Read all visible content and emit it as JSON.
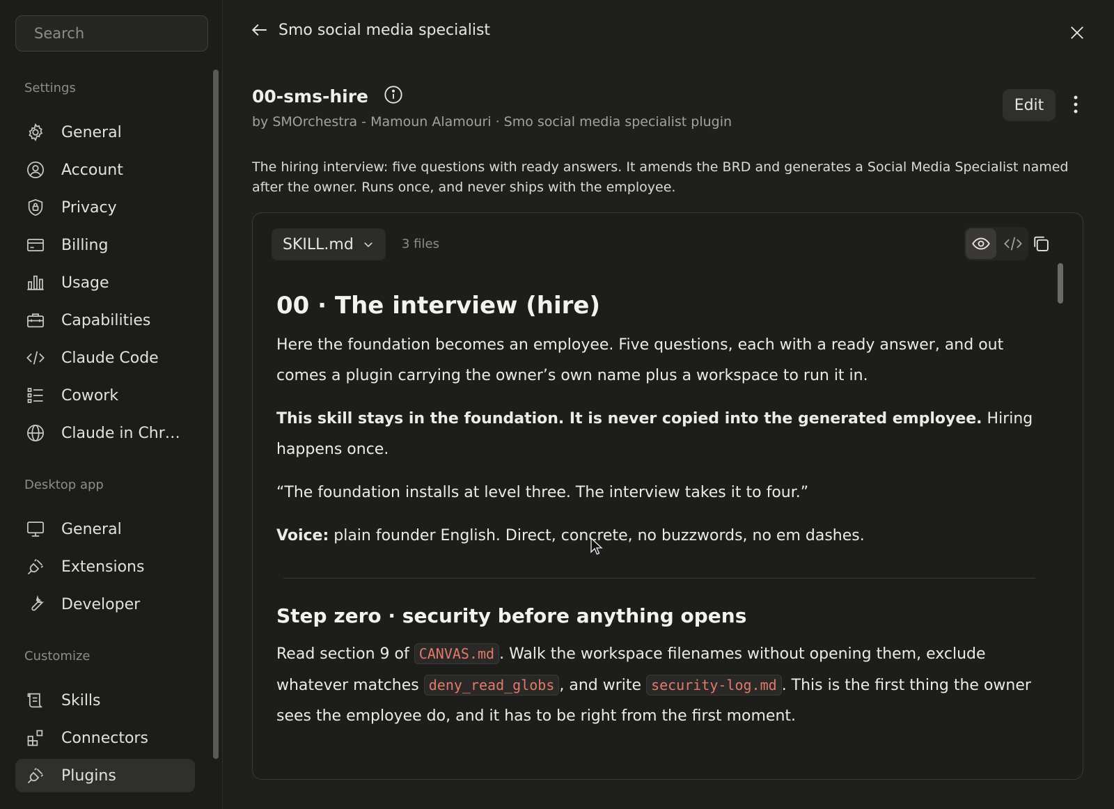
{
  "sidebar": {
    "search_placeholder": "Search",
    "sections": {
      "settings": "Settings",
      "desktop": "Desktop app",
      "customize": "Customize"
    },
    "settings_items": [
      {
        "label": "General",
        "icon": "gear-icon"
      },
      {
        "label": "Account",
        "icon": "user-circle-icon"
      },
      {
        "label": "Privacy",
        "icon": "shield-icon"
      },
      {
        "label": "Billing",
        "icon": "credit-card-icon"
      },
      {
        "label": "Usage",
        "icon": "bar-chart-icon"
      },
      {
        "label": "Capabilities",
        "icon": "briefcase-icon"
      },
      {
        "label": "Claude Code",
        "icon": "code-icon"
      },
      {
        "label": "Cowork",
        "icon": "list-icon"
      },
      {
        "label": "Claude in Chr…",
        "icon": "globe-icon"
      }
    ],
    "desktop_items": [
      {
        "label": "General",
        "icon": "monitor-icon"
      },
      {
        "label": "Extensions",
        "icon": "plug-icon"
      },
      {
        "label": "Developer",
        "icon": "wrench-icon"
      }
    ],
    "customize_items": [
      {
        "label": "Skills",
        "icon": "scroll-icon"
      },
      {
        "label": "Connectors",
        "icon": "blocks-icon"
      },
      {
        "label": "Plugins",
        "icon": "plug-icon",
        "active": true
      }
    ]
  },
  "header": {
    "back_title": "Smo social media specialist"
  },
  "plugin": {
    "name": "00-sms-hire",
    "byline": "by SMOrchestra - Mamoun Alamouri · Smo social media specialist plugin",
    "edit_label": "Edit",
    "description": "The hiring interview: five questions with ready answers. It amends the BRD and generates a Social Media Specialist named after the owner. Runs once, and never ships with the employee."
  },
  "file_viewer": {
    "selected_file": "SKILL.md",
    "files_count": "3 files"
  },
  "doc": {
    "h1": "00 · The interview (hire)",
    "p1": "Here the foundation becomes an employee. Five questions, each with a ready answer, and out comes a plugin carrying the owner’s own name plus a workspace to run it in.",
    "p2_bold": "This skill stays in the foundation. It is never copied into the generated employee.",
    "p2_rest": " Hiring happens once.",
    "p3": "“The foundation installs at level three. The interview takes it to four.”",
    "p4_bold": "Voice:",
    "p4_rest": " plain founder English. Direct, concrete, no buzzwords, no em dashes.",
    "h2": "Step zero · security before anything opens",
    "p5_a": "Read section 9 of ",
    "p5_code1": "CANVAS.md",
    "p5_b": ". Walk the workspace filenames without opening them, exclude whatever matches ",
    "p5_code2": "deny_read_globs",
    "p5_c": ", and write ",
    "p5_code3": "security-log.md",
    "p5_d": ". This is the first thing the owner sees the employee do, and it has to be right from the first moment."
  }
}
